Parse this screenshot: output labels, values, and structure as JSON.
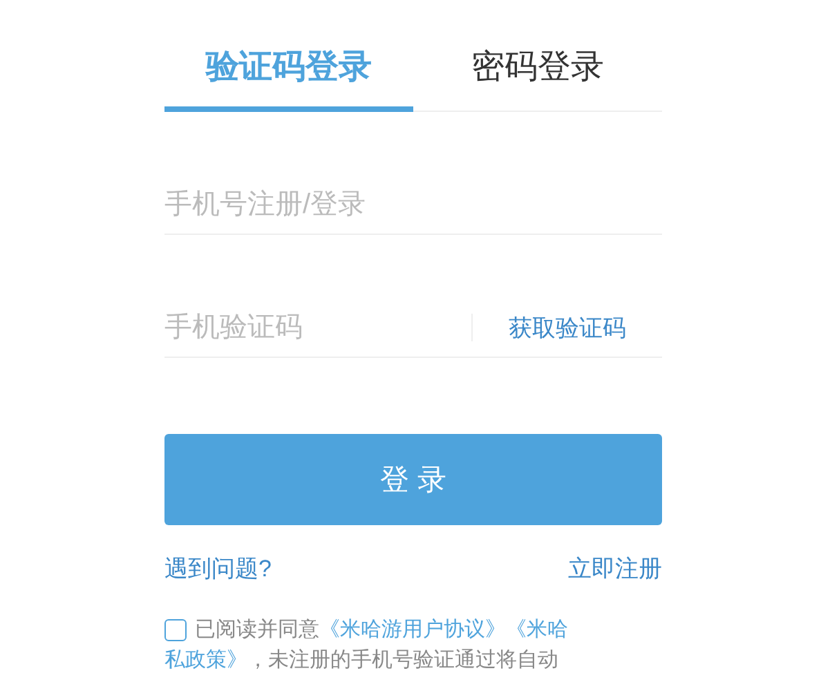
{
  "tabs": [
    {
      "label": "验证码登录",
      "selected": true
    },
    {
      "label": "密码登录",
      "selected": false
    }
  ],
  "phone_field": {
    "placeholder": "手机号注册/登录"
  },
  "code_field": {
    "placeholder": "手机验证码",
    "action": "获取验证码"
  },
  "login_button": "登 录",
  "links": {
    "help": "遇到问题?",
    "register": "立即注册"
  },
  "agreement": {
    "checked": false,
    "lines": [
      [
        {
          "kind": "text",
          "text": "已阅读并同意"
        },
        {
          "kind": "link",
          "text": "《米哈游用户协议》"
        },
        {
          "kind": "link",
          "text": "《米哈"
        }
      ],
      [
        {
          "kind": "link",
          "text": "私政策》"
        },
        {
          "kind": "text",
          "text": "，未注册的手机号验证通过将自动"
        }
      ]
    ]
  }
}
